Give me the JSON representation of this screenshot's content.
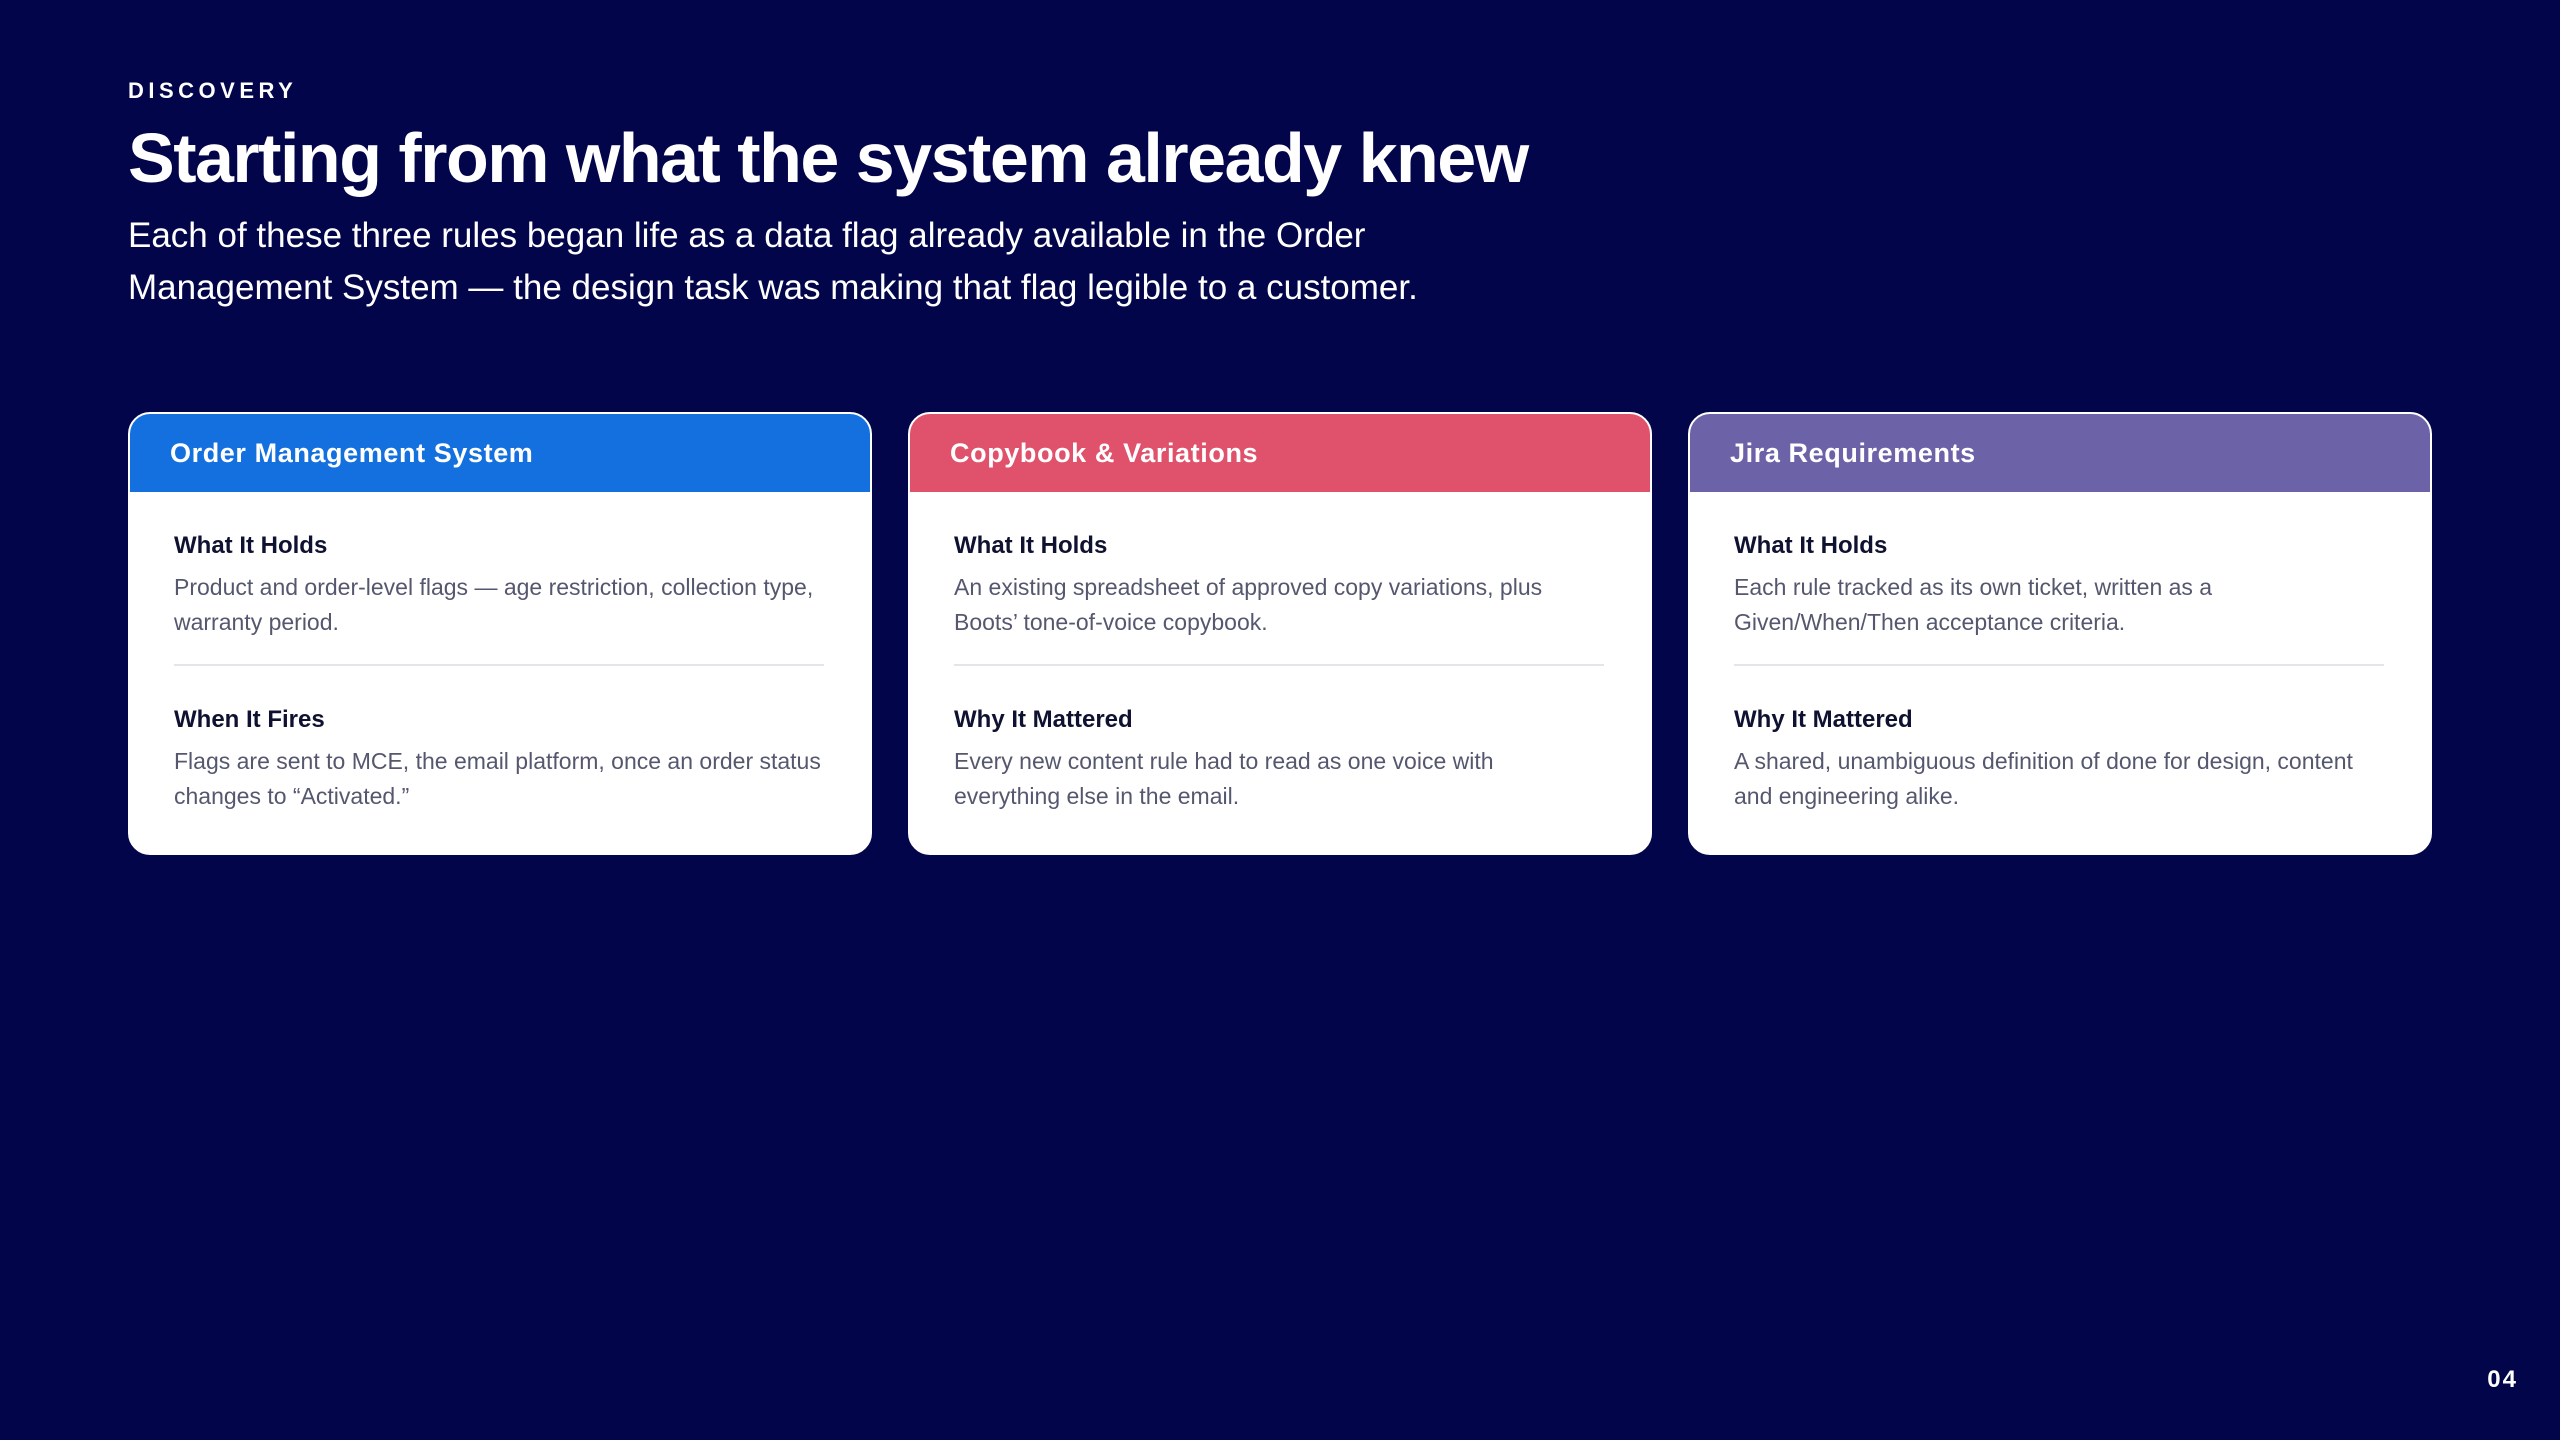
{
  "eyebrow": "DISCOVERY",
  "title": "Starting from what the system already knew",
  "subtitle": "Each of these three rules began life as a data flag already available in the Order Management System — the design task was making that flag legible to a customer.",
  "cards": [
    {
      "title": "Order Management System",
      "color": "#1470de",
      "sections": [
        {
          "label": "What It Holds",
          "text": "Product and order-level flags — age restriction, collection type, warranty period."
        },
        {
          "label": "When It Fires",
          "text": "Flags are sent to MCE, the email platform, once an order status changes to “Activated.”"
        }
      ]
    },
    {
      "title": "Copybook & Variations",
      "color": "#e0526b",
      "sections": [
        {
          "label": "What It Holds",
          "text": "An existing spreadsheet of approved copy variations, plus Boots’ tone-of-voice copybook."
        },
        {
          "label": "Why It Mattered",
          "text": "Every new content rule had to read as one voice with everything else in the email."
        }
      ]
    },
    {
      "title": "Jira Requirements",
      "color": "#6c62a8",
      "sections": [
        {
          "label": "What It Holds",
          "text": "Each rule tracked as its own ticket, written as a Given/When/Then acceptance criteria."
        },
        {
          "label": "Why It Mattered",
          "text": "A shared, unambiguous definition of done for design, content and engineering alike."
        }
      ]
    }
  ],
  "page_number": "04"
}
